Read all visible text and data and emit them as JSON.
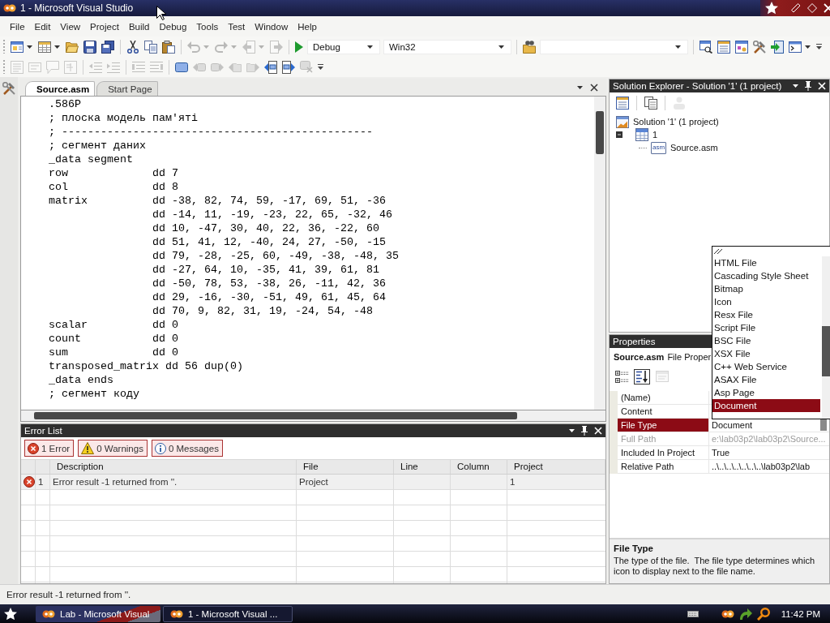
{
  "window": {
    "title": "1 - Microsoft Visual Studio"
  },
  "menu": [
    "File",
    "Edit",
    "View",
    "Project",
    "Build",
    "Debug",
    "Tools",
    "Test",
    "Window",
    "Help"
  ],
  "toolbar_1": [
    {
      "kind": "newproject",
      "disabled": false
    },
    {
      "kind": "caret",
      "disabled": false
    },
    {
      "kind": "additem",
      "disabled": false
    },
    {
      "kind": "caret",
      "disabled": false
    },
    {
      "kind": "open",
      "disabled": false
    },
    {
      "kind": "save",
      "disabled": false
    },
    {
      "kind": "saveall",
      "disabled": false
    },
    {
      "kind": "separator"
    },
    {
      "kind": "cut",
      "disabled": false
    },
    {
      "kind": "copy",
      "disabled": false
    },
    {
      "kind": "paste",
      "disabled": false
    },
    {
      "kind": "separator"
    },
    {
      "kind": "undo",
      "disabled": true
    },
    {
      "kind": "caret",
      "disabled": true
    },
    {
      "kind": "redo",
      "disabled": true
    },
    {
      "kind": "caret",
      "disabled": true
    },
    {
      "kind": "back",
      "disabled": true
    },
    {
      "kind": "caret",
      "disabled": true
    },
    {
      "kind": "forward",
      "disabled": true
    },
    {
      "kind": "separator"
    },
    {
      "kind": "start",
      "disabled": false
    },
    {
      "kind": "combo",
      "value": "Debug"
    },
    {
      "kind": "combo",
      "value": "Win32"
    },
    {
      "kind": "separator"
    },
    {
      "kind": "findinfiles",
      "disabled": false
    },
    {
      "kind": "combo"
    },
    {
      "kind": "separator"
    },
    {
      "kind": "solutionexplorer",
      "disabled": false
    },
    {
      "kind": "propertieswindow",
      "disabled": false
    },
    {
      "kind": "objectbrowser",
      "disabled": false
    },
    {
      "kind": "toolbox",
      "disabled": false
    },
    {
      "kind": "startpage",
      "disabled": false
    },
    {
      "kind": "command",
      "disabled": false
    },
    {
      "kind": "caret",
      "disabled": false
    },
    {
      "kind": "overflow",
      "disabled": false
    }
  ],
  "toolbar_2": [
    {
      "kind": "memberlist",
      "disabled": true
    },
    {
      "kind": "paraminfo",
      "disabled": true
    },
    {
      "kind": "quickinfo",
      "disabled": true
    },
    {
      "kind": "wordcomplete",
      "disabled": true
    },
    {
      "kind": "separator"
    },
    {
      "kind": "outdent",
      "disabled": true
    },
    {
      "kind": "indent",
      "disabled": true
    },
    {
      "kind": "separator"
    },
    {
      "kind": "comment",
      "disabled": true
    },
    {
      "kind": "uncomment",
      "disabled": true
    },
    {
      "kind": "separator"
    },
    {
      "kind": "bookmark",
      "disabled": false
    },
    {
      "kind": "prevbookmark",
      "disabled": true
    },
    {
      "kind": "nextbookmark",
      "disabled": true
    },
    {
      "kind": "prevfolder",
      "disabled": true
    },
    {
      "kind": "nextfolder",
      "disabled": true
    },
    {
      "kind": "prevdoc",
      "disabled": false
    },
    {
      "kind": "nextdoc",
      "disabled": false
    },
    {
      "kind": "clearbookmarks",
      "disabled": true
    },
    {
      "kind": "overflow",
      "disabled": false
    }
  ],
  "editor": {
    "tabs": [
      {
        "label": "Source.asm",
        "selected": true
      },
      {
        "label": "Start Page",
        "selected": false
      }
    ],
    "code_lines": [
      ".586P",
      "; плоска модель пам'яті",
      "; ------------------------------------------------",
      "; сегмент даних",
      "_data segment",
      "row             dd 7",
      "col             dd 8",
      "matrix          dd -38, 82, 74, 59, -17, 69, 51, -36",
      "                dd -14, 11, -19, -23, 22, 65, -32, 46",
      "                dd 10, -47, 30, 40, 22, 36, -22, 60",
      "                dd 51, 41, 12, -40, 24, 27, -50, -15",
      "                dd 79, -28, -25, 60, -49, -38, -48, 35",
      "                dd -27, 64, 10, -35, 41, 39, 61, 81",
      "                dd -50, 78, 53, -38, 26, -11, 42, 36",
      "                dd 29, -16, -30, -51, 49, 61, 45, 64",
      "                dd 70, 9, 82, 31, 19, -24, 54, -48",
      "scalar          dd 0",
      "count           dd 0",
      "sum             dd 0",
      "transposed_matrix dd 56 dup(0)",
      "_data ends",
      "; сегмент коду"
    ]
  },
  "error_list": {
    "title": "Error List",
    "filters": [
      {
        "kind": "error",
        "label": "1 Error",
        "selected": true
      },
      {
        "kind": "warning",
        "label": "0 Warnings",
        "selected": true
      },
      {
        "kind": "info",
        "label": "0 Messages",
        "selected": true
      }
    ],
    "columns": [
      "Description",
      "File",
      "Line",
      "Column",
      "Project"
    ],
    "rows": [
      {
        "kind": "error",
        "selected": true,
        "number": "1",
        "description": "Error result -1 returned from ''.",
        "file": "Project",
        "project": "1"
      }
    ]
  },
  "solution_explorer": {
    "title": "Solution Explorer - Solution '1' (1 project)",
    "toolbar": [
      {
        "kind": "propertieswindow",
        "disabled": false
      },
      {
        "kind": "showall",
        "disabled": false
      },
      {
        "kind": "classview",
        "disabled": true
      }
    ],
    "tree": [
      {
        "label": "Solution '1' (1 project)",
        "kind": "solution",
        "children": [
          {
            "label": "1",
            "kind": "project",
            "children": [
              {
                "label": "Source.asm",
                "kind": "asm",
                "icon_label": "asm"
              }
            ]
          }
        ]
      }
    ]
  },
  "properties": {
    "title": "Properties",
    "object_name": "Source.asm",
    "object_type": "File Proper",
    "toolbar": [
      {
        "kind": "categorized",
        "selected": false,
        "disabled": false
      },
      {
        "kind": "alphabetical",
        "selected": true,
        "disabled": false
      },
      {
        "kind": "pages",
        "selected": false,
        "disabled": true
      }
    ],
    "rows": [
      {
        "name": "(Name)",
        "kind": "text",
        "selected": false,
        "disabled": false
      },
      {
        "name": "Content",
        "kind": "text",
        "selected": false,
        "disabled": false
      },
      {
        "name": "File Type",
        "value": "Document",
        "kind": "dropdown",
        "selected": true,
        "disabled": false
      },
      {
        "name": "Full Path",
        "value": "e:\\lab03p2\\lab03p2\\Source...",
        "kind": "text",
        "selected": false,
        "disabled": true
      },
      {
        "name": "Included In Project",
        "value": "True",
        "kind": "text",
        "selected": false,
        "disabled": false
      },
      {
        "name": "Relative Path",
        "value": "..\\..\\..\\..\\..\\..\\..\\lab03p2\\lab",
        "kind": "text",
        "selected": false,
        "disabled": false
      }
    ],
    "file_type_list": {
      "items": [
        {
          "label": "HTML File",
          "selected": false
        },
        {
          "label": "Cascading Style Sheet",
          "selected": false
        },
        {
          "label": "Bitmap",
          "selected": false
        },
        {
          "label": "Icon",
          "selected": false
        },
        {
          "label": "Resx File",
          "selected": false
        },
        {
          "label": "Script File",
          "selected": false
        },
        {
          "label": "BSC File",
          "selected": false
        },
        {
          "label": "XSX File",
          "selected": false
        },
        {
          "label": "C++ Web Service",
          "selected": false
        },
        {
          "label": "ASAX File",
          "selected": false
        },
        {
          "label": "Asp Page",
          "selected": false
        },
        {
          "label": "Document",
          "selected": true
        }
      ]
    },
    "description": {
      "title": "File Type",
      "text": "The type of the file.  The file type determines which icon to display next to the file name."
    }
  },
  "status_bar": {
    "text": "Error result -1 returned from ''."
  },
  "taskbar": {
    "tasks": [
      {
        "label": "Lab - Microsoft Visual",
        "selected": false
      },
      {
        "label": "1 - Microsoft Visual ...",
        "selected": true
      }
    ],
    "clock": "11:42 PM"
  }
}
